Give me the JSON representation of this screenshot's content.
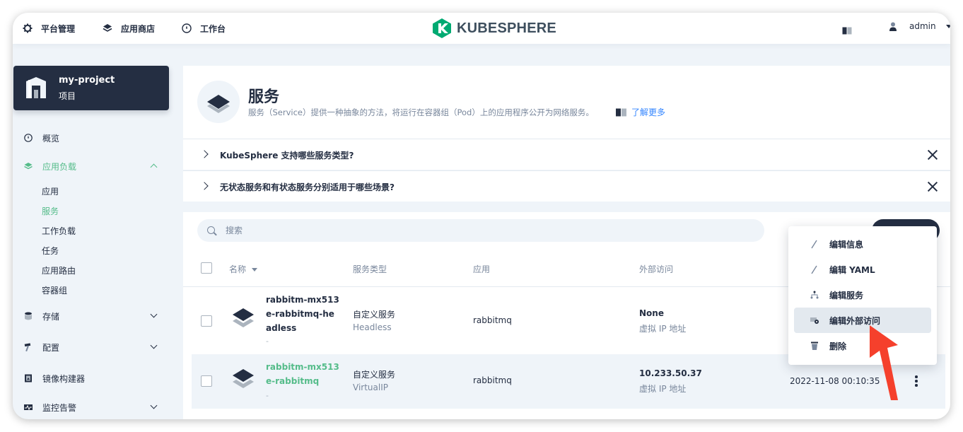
{
  "topbar": {
    "nav": [
      {
        "label": "平台管理",
        "icon": "gear-icon"
      },
      {
        "label": "应用商店",
        "icon": "layers-icon"
      },
      {
        "label": "工作台",
        "icon": "dashboard-icon"
      }
    ],
    "brand": "KUBESPHERE",
    "user": "admin"
  },
  "project": {
    "name": "my-project",
    "type": "项目"
  },
  "sidebar": {
    "overview": "概览",
    "workloads": "应用负载",
    "workload_items": [
      "应用",
      "服务",
      "工作负载",
      "任务",
      "应用路由",
      "容器组"
    ],
    "storage": "存储",
    "config": "配置",
    "image_builder": "镜像构建器",
    "monitoring": "监控告警"
  },
  "banner": {
    "title": "服务",
    "description": "服务（Service）提供一种抽象的方法，将运行在容器组（Pod）上的应用程序公开为网络服务。",
    "learn_more": "了解更多"
  },
  "faq": [
    "KubeSphere 支持哪些服务类型?",
    "无状态服务和有状态服务分别适用于哪些场景?"
  ],
  "search": {
    "placeholder": "搜索"
  },
  "table": {
    "headers": {
      "name": "名称",
      "type": "服务类型",
      "app": "应用",
      "external": "外部访问"
    },
    "rows": [
      {
        "name": "rabbitm-mx513e-rabbitmq-headless",
        "desc": "-",
        "type": "自定义服务",
        "type_sub": "Headless",
        "app": "rabbitmq",
        "external": "None",
        "external_sub": "虚拟 IP 地址",
        "created": ""
      },
      {
        "name": "rabbitm-mx513e-rabbitmq",
        "desc": "-",
        "type": "自定义服务",
        "type_sub": "VirtualIP",
        "app": "rabbitmq",
        "external": "10.233.50.37",
        "external_sub": "虚拟 IP 地址",
        "created": "2022-11-08 00:10:35"
      }
    ]
  },
  "menu": {
    "items": [
      {
        "label": "编辑信息",
        "icon": "pen-icon"
      },
      {
        "label": "编辑 YAML",
        "icon": "pen-icon"
      },
      {
        "label": "编辑服务",
        "icon": "topology-icon"
      },
      {
        "label": "编辑外部访问",
        "icon": "network-icon"
      },
      {
        "label": "删除",
        "icon": "trash-icon"
      }
    ],
    "highlighted_index": 3
  },
  "colors": {
    "primary_dark": "#242e42",
    "green": "#55bc8a",
    "link_blue": "#3385ff",
    "annotation_red": "#f5402c"
  }
}
